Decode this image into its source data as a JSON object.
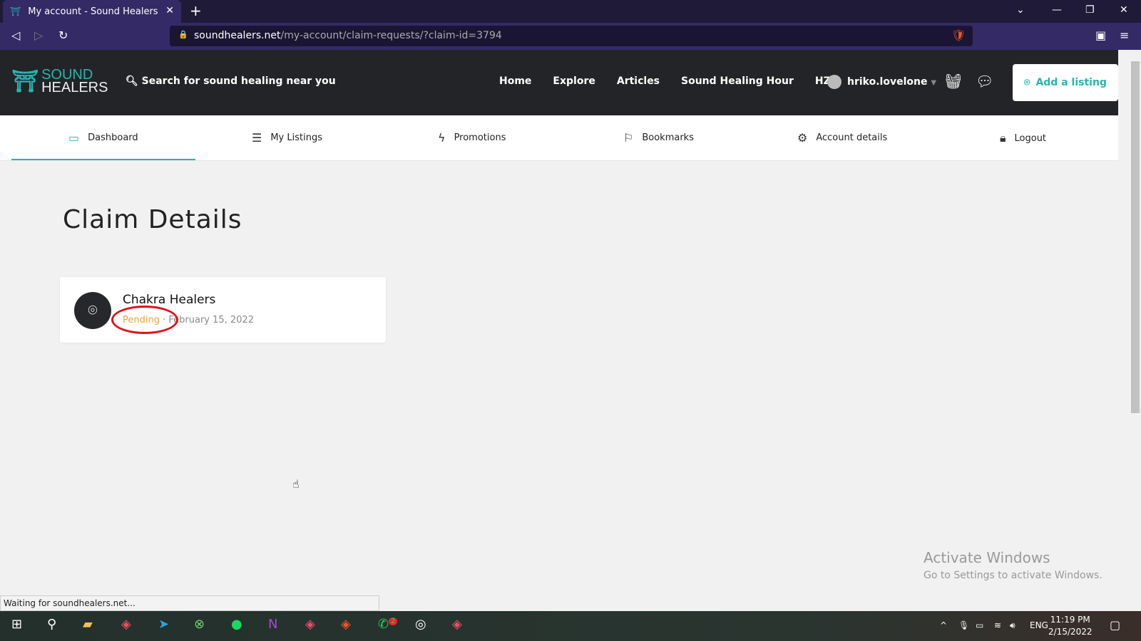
{
  "browser": {
    "tab_title": "My account - Sound Healers",
    "url_host": "soundhealers.net",
    "url_path": "/my-account/claim-requests/?claim-id=3794",
    "status": "Waiting for soundhealers.net..."
  },
  "site": {
    "logo_line1": "SOUND",
    "logo_line2": "HEALERS",
    "search_placeholder": "Search for sound healing near you",
    "menu": [
      "Home",
      "Explore",
      "Articles",
      "Sound Healing Hour",
      "HZP"
    ],
    "username": "hriko.lovelone",
    "add_listing": "Add a listing"
  },
  "subnav": [
    {
      "label": "Dashboard",
      "icon": "laptop-icon"
    },
    {
      "label": "My Listings",
      "icon": "list-icon"
    },
    {
      "label": "Promotions",
      "icon": "bolt-icon"
    },
    {
      "label": "Bookmarks",
      "icon": "bookmark-icon"
    },
    {
      "label": "Account details",
      "icon": "settings-icon"
    },
    {
      "label": "Logout",
      "icon": "lock-icon"
    }
  ],
  "page": {
    "title": "Claim Details",
    "claim": {
      "name": "Chakra Healers",
      "status": "Pending",
      "separator": "·",
      "date": "February 15, 2022"
    }
  },
  "watermark": {
    "line1": "Activate Windows",
    "line2": "Go to Settings to activate Windows."
  },
  "taskbar": {
    "lang": "ENG",
    "time": "11:19 PM",
    "date": "2/15/2022",
    "whatsapp_badge": "2"
  },
  "colors": {
    "accent": "#27b5b0",
    "pending": "#eea33a",
    "header": "#232427"
  }
}
